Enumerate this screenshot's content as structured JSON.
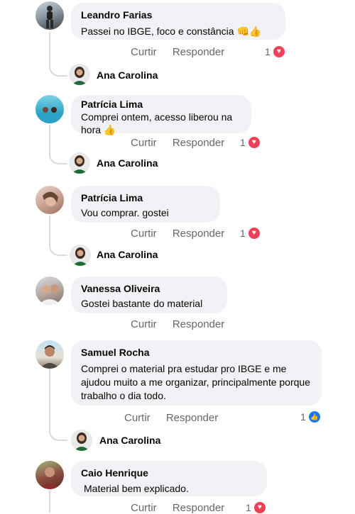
{
  "comments": [
    {
      "name": "Leandro Farias",
      "text": "Passei no IBGE, foco e constância 👊👍",
      "like_label": "Curtir",
      "reply_label": "Responder",
      "reaction_count": "1",
      "reaction_type": "heart"
    },
    {
      "name": "Patrícia Lima",
      "text": "Comprei ontem, acesso liberou na hora 👍",
      "like_label": "Curtir",
      "reply_label": "Responder",
      "reaction_count": "1",
      "reaction_type": "heart"
    },
    {
      "name": "Patrícia Lima",
      "text": "Vou comprar. gostei",
      "like_label": "Curtir",
      "reply_label": "Responder",
      "reaction_count": "1",
      "reaction_type": "heart"
    },
    {
      "name": "Vanessa Oliveira",
      "text": "Gostei bastante do material",
      "like_label": "Curtir",
      "reply_label": "Responder"
    },
    {
      "name": "Samuel Rocha",
      "text": "Comprei o material pra estudar pro IBGE e me ajudou muito a me organizar, principalmente porque trabalho o dia todo.",
      "like_label": "Curtir",
      "reply_label": "Responder",
      "reaction_count": "1",
      "reaction_type": "like"
    },
    {
      "name": "Caio Henrique",
      "text": "Material bem explicado.",
      "like_label": "Curtir",
      "reply_label": "Responder",
      "reaction_count": "1",
      "reaction_type": "heart"
    }
  ],
  "reply_author": "Ana Carolina",
  "icons": {
    "heart": "heart-icon",
    "like": "thumbs-up-icon"
  },
  "colors": {
    "bubble": "#f0f2f5",
    "heart": "#f33e58",
    "like": "#1877f2",
    "muted": "#65676b",
    "brand_green": "#1f6b35"
  }
}
